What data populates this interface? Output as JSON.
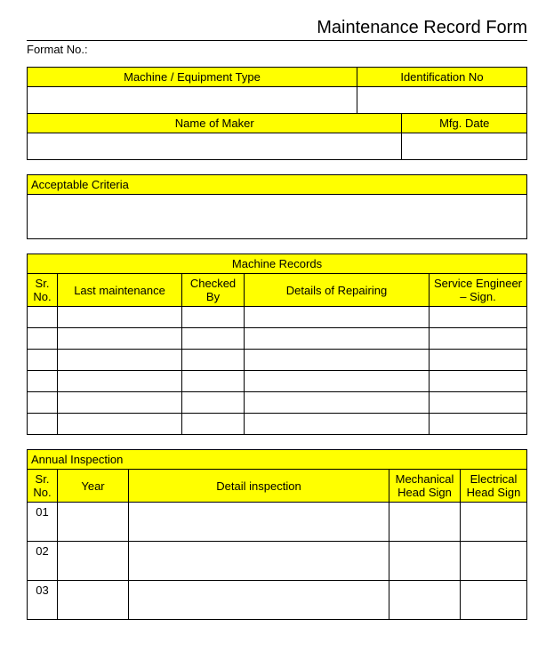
{
  "title": "Maintenance Record Form",
  "format_label": "Format No.:",
  "t1": {
    "machine_type": "Machine / Equipment Type",
    "ident_no": "Identification No",
    "maker": "Name of Maker",
    "mfg_date": "Mfg. Date"
  },
  "t2": {
    "header": "Acceptable Criteria"
  },
  "t3": {
    "title": "Machine Records",
    "sr": "Sr. No.",
    "last_maint": "Last maintenance",
    "checked_by": "Checked By",
    "details": "Details of Repairing",
    "service_eng": "Service Engineer – Sign."
  },
  "t4": {
    "title": "Annual Inspection",
    "sr": "Sr. No.",
    "year": "Year",
    "detail": "Detail inspection",
    "mech": "Mechanical Head Sign",
    "elec": "Electrical Head Sign",
    "rows": [
      "01",
      "02",
      "03"
    ]
  }
}
